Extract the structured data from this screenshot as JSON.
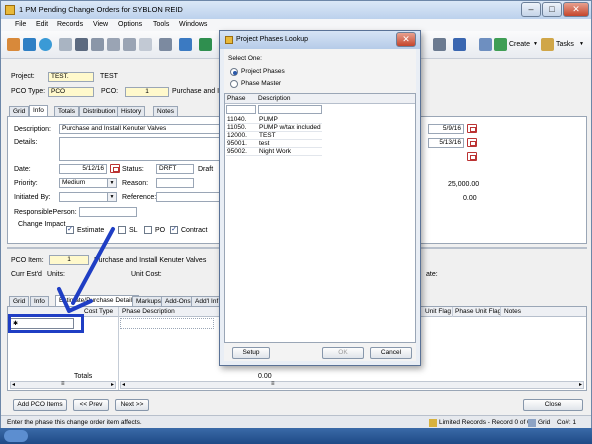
{
  "window": {
    "title": "1 PM Pending Change Orders for SYBLON REID"
  },
  "menu": [
    "File",
    "Edit",
    "Records",
    "View",
    "Options",
    "Tools",
    "Windows"
  ],
  "toolbar_right": {
    "create": "Create",
    "tasks": "Tasks"
  },
  "header": {
    "project_label": "Project:",
    "project_value": "TEST.",
    "project_name": "TEST",
    "pco_type_label": "PCO Type:",
    "pco_type_value": "PCO",
    "pco_label": "PCO:",
    "pco_value": "1",
    "pco_desc": "Purchase and Ins"
  },
  "top_tabs": [
    "Grid",
    "Info",
    "Totals",
    "Distribution",
    "History",
    "Notes"
  ],
  "info": {
    "description_label": "Description:",
    "description_value": "Purchase and Install Kenuter Valves",
    "details_label": "Details:",
    "date_label": "Date:",
    "date_value": "5/12/16",
    "status_label": "Status:",
    "status_value": "DRFT",
    "status_desc": "Draft",
    "priority_label": "Priority:",
    "priority_value": "Medium",
    "reason_label": "Reason:",
    "initiated_label": "Initiated By:",
    "reference_label": "Reference:",
    "responsible_label": "ResponsiblePerson:",
    "change_impact_label": "Change Impact",
    "estimate_label": "Estimate",
    "sl_label": "SL",
    "po_label": "PO",
    "contract_label": "Contract",
    "right_date1": "5/9/16",
    "right_date2": "5/13/16",
    "right_amount1": "25,000.00",
    "right_amount2": "0.00"
  },
  "item": {
    "pco_item_label": "PCO Item:",
    "pco_item_value": "1",
    "pco_item_desc": "Purchase and Install Kenuter Valves",
    "curr_est_label": "Curr Est'd",
    "units_label": "Units:",
    "unit_cost_label": "Unit Cost:",
    "te_label": "ate:"
  },
  "bottom_tabs": [
    "Grid",
    "Info",
    "Estimate/Purchase Details",
    "Markups",
    "Add-Ons",
    "Add'l Inf"
  ],
  "details_grid": {
    "cost_type": "Cost Type",
    "phase_desc": "Phase Description",
    "unit_flag": "Unit Flag",
    "phase_unit_flag": "Phase Unit Flag",
    "notes": "Notes",
    "totals": "Totals",
    "total_value": "0.00"
  },
  "buttons": {
    "add_items": "Add PCO Items",
    "prev": "<< Prev",
    "next": "Next >>",
    "close": "Close"
  },
  "status": {
    "message": "Enter the phase this change order item affects.",
    "records": "Limited Records - Record 0 of 0",
    "grid": "Grid",
    "co": "Co#: 1"
  },
  "dialog": {
    "title": "Project Phases Lookup",
    "select_label": "Select One:",
    "opt1": "Project Phases",
    "opt2": "Phase Master",
    "col_phase": "Phase",
    "col_desc": "Description",
    "rows": [
      {
        "phase": "11040.",
        "desc": "PUMP"
      },
      {
        "phase": "11050.",
        "desc": "PUMP w/tax included"
      },
      {
        "phase": "12000.",
        "desc": "TEST"
      },
      {
        "phase": "95001.",
        "desc": "test"
      },
      {
        "phase": "95002.",
        "desc": "Night Work"
      }
    ],
    "setup": "Setup",
    "ok": "OK",
    "cancel": "Cancel"
  },
  "colors": {
    "highlight": "#1f3ec4",
    "accent": "#2a58a8"
  }
}
